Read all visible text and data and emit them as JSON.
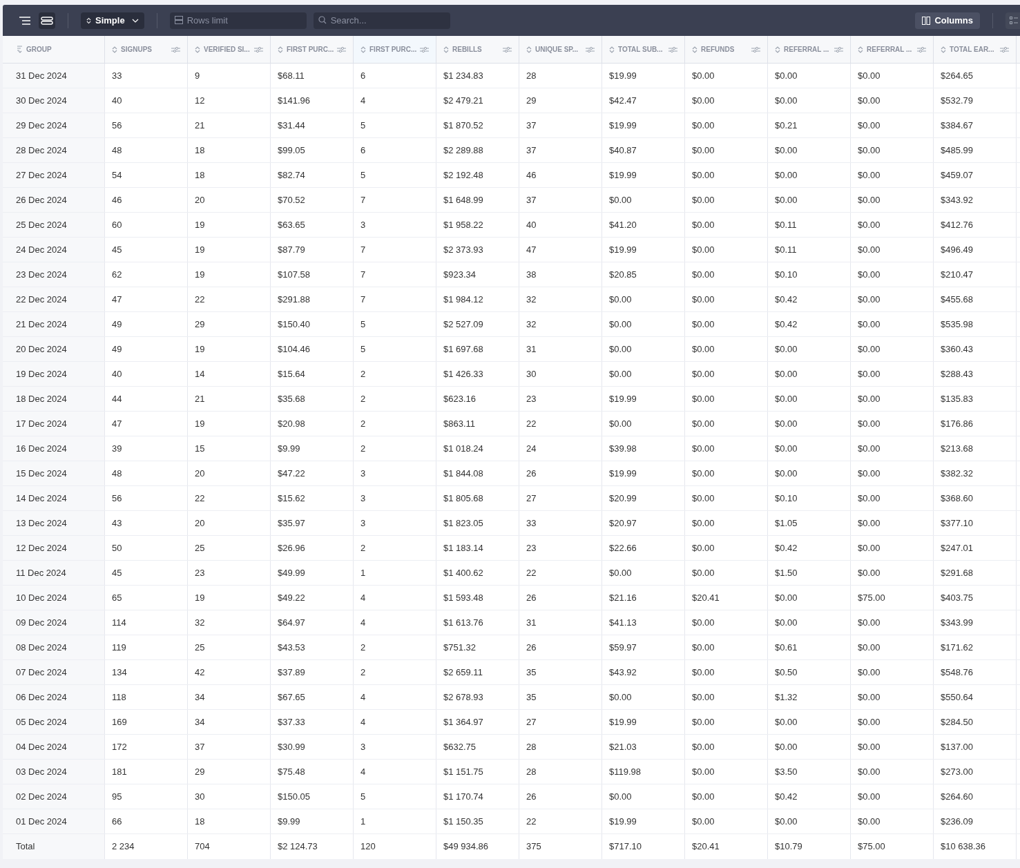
{
  "toolbar": {
    "view_toggles": [
      {
        "kind": "tree",
        "selected": false
      },
      {
        "kind": "rows",
        "selected": true
      }
    ],
    "mode": "Simple",
    "rows_limit": {
      "placeholder": "Rows limit"
    },
    "search": {
      "placeholder": "Search..."
    },
    "columns_button": "Columns"
  },
  "table": {
    "columns": [
      {
        "label": "GROUP",
        "kind": "group"
      },
      {
        "label": "SIGNUPS"
      },
      {
        "label": "VERIFIED SI..."
      },
      {
        "label": "FIRST PURC..."
      },
      {
        "label": "FIRST PURC..."
      },
      {
        "label": "REBILLS"
      },
      {
        "label": "UNIQUE SP..."
      },
      {
        "label": "TOTAL SUB..."
      },
      {
        "label": "REFUNDS"
      },
      {
        "label": "REFERRAL ..."
      },
      {
        "label": "REFERRAL ..."
      },
      {
        "label": "TOTAL EAR..."
      }
    ],
    "rows": [
      [
        "31 Dec 2024",
        "33",
        "9",
        "$68.11",
        "6",
        "$1 234.83",
        "28",
        "$19.99",
        "$0.00",
        "$0.00",
        "$0.00",
        "$264.65"
      ],
      [
        "30 Dec 2024",
        "40",
        "12",
        "$141.96",
        "4",
        "$2 479.21",
        "29",
        "$42.47",
        "$0.00",
        "$0.00",
        "$0.00",
        "$532.79"
      ],
      [
        "29 Dec 2024",
        "56",
        "21",
        "$31.44",
        "5",
        "$1 870.52",
        "37",
        "$19.99",
        "$0.00",
        "$0.21",
        "$0.00",
        "$384.67"
      ],
      [
        "28 Dec 2024",
        "48",
        "18",
        "$99.05",
        "6",
        "$2 289.88",
        "37",
        "$40.87",
        "$0.00",
        "$0.00",
        "$0.00",
        "$485.99"
      ],
      [
        "27 Dec 2024",
        "54",
        "18",
        "$82.74",
        "5",
        "$2 192.48",
        "46",
        "$19.99",
        "$0.00",
        "$0.00",
        "$0.00",
        "$459.07"
      ],
      [
        "26 Dec 2024",
        "46",
        "20",
        "$70.52",
        "7",
        "$1 648.99",
        "37",
        "$0.00",
        "$0.00",
        "$0.00",
        "$0.00",
        "$343.92"
      ],
      [
        "25 Dec 2024",
        "60",
        "19",
        "$63.65",
        "3",
        "$1 958.22",
        "40",
        "$41.20",
        "$0.00",
        "$0.11",
        "$0.00",
        "$412.76"
      ],
      [
        "24 Dec 2024",
        "45",
        "19",
        "$87.79",
        "7",
        "$2 373.93",
        "47",
        "$19.99",
        "$0.00",
        "$0.11",
        "$0.00",
        "$496.49"
      ],
      [
        "23 Dec 2024",
        "62",
        "19",
        "$107.58",
        "7",
        "$923.34",
        "38",
        "$20.85",
        "$0.00",
        "$0.10",
        "$0.00",
        "$210.47"
      ],
      [
        "22 Dec 2024",
        "47",
        "22",
        "$291.88",
        "7",
        "$1 984.12",
        "32",
        "$0.00",
        "$0.00",
        "$0.42",
        "$0.00",
        "$455.68"
      ],
      [
        "21 Dec 2024",
        "49",
        "29",
        "$150.40",
        "5",
        "$2 527.09",
        "32",
        "$0.00",
        "$0.00",
        "$0.42",
        "$0.00",
        "$535.98"
      ],
      [
        "20 Dec 2024",
        "49",
        "19",
        "$104.46",
        "5",
        "$1 697.68",
        "31",
        "$0.00",
        "$0.00",
        "$0.00",
        "$0.00",
        "$360.43"
      ],
      [
        "19 Dec 2024",
        "40",
        "14",
        "$15.64",
        "2",
        "$1 426.33",
        "30",
        "$0.00",
        "$0.00",
        "$0.00",
        "$0.00",
        "$288.43"
      ],
      [
        "18 Dec 2024",
        "44",
        "21",
        "$35.68",
        "2",
        "$623.16",
        "23",
        "$19.99",
        "$0.00",
        "$0.00",
        "$0.00",
        "$135.83"
      ],
      [
        "17 Dec 2024",
        "47",
        "19",
        "$20.98",
        "2",
        "$863.11",
        "22",
        "$0.00",
        "$0.00",
        "$0.00",
        "$0.00",
        "$176.86"
      ],
      [
        "16 Dec 2024",
        "39",
        "15",
        "$9.99",
        "2",
        "$1 018.24",
        "24",
        "$39.98",
        "$0.00",
        "$0.00",
        "$0.00",
        "$213.68"
      ],
      [
        "15 Dec 2024",
        "48",
        "20",
        "$47.22",
        "3",
        "$1 844.08",
        "26",
        "$19.99",
        "$0.00",
        "$0.00",
        "$0.00",
        "$382.32"
      ],
      [
        "14 Dec 2024",
        "56",
        "22",
        "$15.62",
        "3",
        "$1 805.68",
        "27",
        "$20.99",
        "$0.00",
        "$0.10",
        "$0.00",
        "$368.60"
      ],
      [
        "13 Dec 2024",
        "43",
        "20",
        "$35.97",
        "3",
        "$1 823.05",
        "33",
        "$20.97",
        "$0.00",
        "$1.05",
        "$0.00",
        "$377.10"
      ],
      [
        "12 Dec 2024",
        "50",
        "25",
        "$26.96",
        "2",
        "$1 183.14",
        "23",
        "$22.66",
        "$0.00",
        "$0.42",
        "$0.00",
        "$247.01"
      ],
      [
        "11 Dec 2024",
        "45",
        "23",
        "$49.99",
        "1",
        "$1 400.62",
        "22",
        "$0.00",
        "$0.00",
        "$1.50",
        "$0.00",
        "$291.68"
      ],
      [
        "10 Dec 2024",
        "65",
        "19",
        "$49.22",
        "4",
        "$1 593.48",
        "26",
        "$21.16",
        "$20.41",
        "$0.00",
        "$75.00",
        "$403.75"
      ],
      [
        "09 Dec 2024",
        "114",
        "32",
        "$64.97",
        "4",
        "$1 613.76",
        "31",
        "$41.13",
        "$0.00",
        "$0.00",
        "$0.00",
        "$343.99"
      ],
      [
        "08 Dec 2024",
        "119",
        "25",
        "$43.53",
        "2",
        "$751.32",
        "26",
        "$59.97",
        "$0.00",
        "$0.61",
        "$0.00",
        "$171.62"
      ],
      [
        "07 Dec 2024",
        "134",
        "42",
        "$37.89",
        "2",
        "$2 659.11",
        "35",
        "$43.92",
        "$0.00",
        "$0.50",
        "$0.00",
        "$548.76"
      ],
      [
        "06 Dec 2024",
        "118",
        "34",
        "$67.65",
        "4",
        "$2 678.93",
        "35",
        "$0.00",
        "$0.00",
        "$1.32",
        "$0.00",
        "$550.64"
      ],
      [
        "05 Dec 2024",
        "169",
        "34",
        "$37.33",
        "4",
        "$1 364.97",
        "27",
        "$19.99",
        "$0.00",
        "$0.00",
        "$0.00",
        "$284.50"
      ],
      [
        "04 Dec 2024",
        "172",
        "37",
        "$30.99",
        "3",
        "$632.75",
        "28",
        "$21.03",
        "$0.00",
        "$0.00",
        "$0.00",
        "$137.00"
      ],
      [
        "03 Dec 2024",
        "181",
        "29",
        "$75.48",
        "4",
        "$1 151.75",
        "28",
        "$119.98",
        "$0.00",
        "$3.50",
        "$0.00",
        "$273.00"
      ],
      [
        "02 Dec 2024",
        "95",
        "30",
        "$150.05",
        "5",
        "$1 170.74",
        "26",
        "$0.00",
        "$0.00",
        "$0.42",
        "$0.00",
        "$264.60"
      ],
      [
        "01 Dec 2024",
        "66",
        "18",
        "$9.99",
        "1",
        "$1 150.35",
        "22",
        "$19.99",
        "$0.00",
        "$0.00",
        "$0.00",
        "$236.09"
      ]
    ],
    "total": [
      "Total",
      "2 234",
      "704",
      "$2 124.73",
      "120",
      "$49 934.86",
      "375",
      "$717.10",
      "$20.41",
      "$10.79",
      "$75.00",
      "$10 638.36"
    ]
  }
}
